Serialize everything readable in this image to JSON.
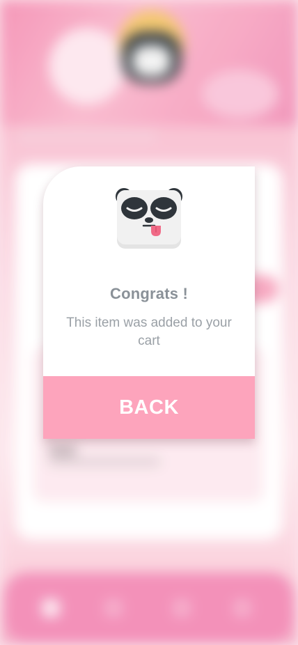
{
  "dialog": {
    "title": "Congrats !",
    "message": "This item was added to your cart",
    "back_label": "BACK",
    "icon": "panda-tongue-icon"
  },
  "colors": {
    "accent": "#fda4bc",
    "title_text": "#8a9198",
    "body_text": "#9aa0a6",
    "background_pink": "#f7a9c1"
  }
}
